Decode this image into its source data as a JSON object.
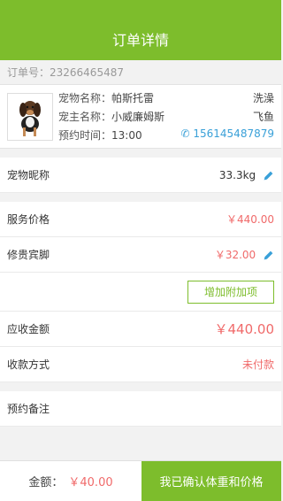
{
  "header": {
    "title": "订单详情"
  },
  "order": {
    "number_text": "订单号：23266465487"
  },
  "pet": {
    "name_label": "宠物名称：",
    "name_value": "帕斯托雷",
    "service": "洗澡",
    "owner_label": "宠主名称：",
    "owner_value": "小威廉姆斯",
    "owner_tag": "飞鱼",
    "time_label": "预约时间：",
    "time_value": "13:00",
    "phone": "✆ 156145487879"
  },
  "nickname": {
    "label": "宠物昵称",
    "value": "33.3kg"
  },
  "service_price": {
    "label": "服务价格",
    "value": "￥440.00"
  },
  "extra_fee": {
    "label": "修贵宾脚",
    "value": "￥32.00"
  },
  "add_button": {
    "label": "增加附加项"
  },
  "receivable": {
    "label": "应收金额",
    "value": "￥440.00"
  },
  "payment": {
    "label": "收款方式",
    "value": "未付款"
  },
  "remark": {
    "label": "预约备注"
  },
  "footer": {
    "total_label": "金额：",
    "total_value": "￥40.00",
    "confirm_label": "我已确认体重和价格"
  },
  "colors": {
    "accent": "#7dbd2c",
    "price": "#f06a6a",
    "link": "#39a0d8"
  }
}
